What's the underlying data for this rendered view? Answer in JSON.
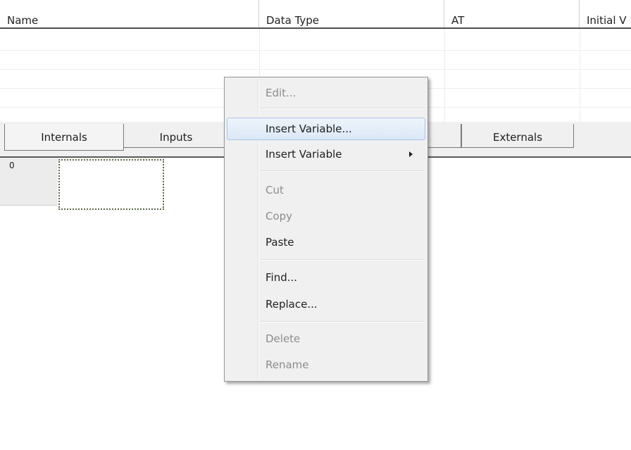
{
  "columns": [
    "Name",
    "Data Type",
    "AT",
    "Initial V"
  ],
  "tabs": {
    "internals": "Internals",
    "inputs": "Inputs",
    "externals": "Externals"
  },
  "row_number": "0",
  "context_menu": {
    "edit": "Edit...",
    "insert_variable_dialog": "Insert Variable...",
    "insert_variable_submenu": "Insert Variable",
    "cut": "Cut",
    "copy": "Copy",
    "paste": "Paste",
    "find": "Find...",
    "replace": "Replace...",
    "delete": "Delete",
    "rename": "Rename"
  }
}
